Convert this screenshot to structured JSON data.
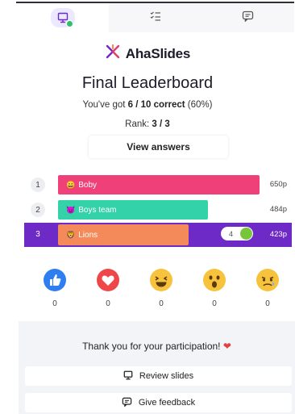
{
  "tabs": [
    {
      "icon": "presentation-icon",
      "active": true
    },
    {
      "icon": "checklist-icon",
      "active": false
    },
    {
      "icon": "chat-icon",
      "active": false
    }
  ],
  "brand": {
    "name": "AhaSlides",
    "accent": "#e23c6b"
  },
  "heading": {
    "title": "Final Leaderboard"
  },
  "score": {
    "prefix": "You've got ",
    "value": "6 / 10 correct",
    "percent": " (60%)",
    "rank_label": "Rank: ",
    "rank_value": "3 / 3"
  },
  "view_answers_label": "View answers",
  "leaderboard": [
    {
      "rank": "1",
      "name": "Boby",
      "points": "650p",
      "color": "#f0407a",
      "emoji": "😄"
    },
    {
      "rank": "2",
      "name": "Boys team",
      "points": "484p",
      "color": "#34d2a9",
      "emoji": "😈"
    },
    {
      "rank": "3",
      "name": "Lions",
      "points": "423p",
      "color": "#f48a59",
      "emoji": "🦁",
      "me": true,
      "toggle_value": "4"
    }
  ],
  "reactions": [
    {
      "icon": "thumbs-up-icon",
      "count": "0",
      "color": "#2e7ef2"
    },
    {
      "icon": "heart-icon",
      "count": "0",
      "color": "#ef4747"
    },
    {
      "icon": "laughing-face-icon",
      "count": "0",
      "color": "#f7c33c"
    },
    {
      "icon": "surprised-face-icon",
      "count": "0",
      "color": "#f7c33c"
    },
    {
      "icon": "sad-face-icon",
      "count": "0",
      "color": "#f7c33c"
    }
  ],
  "footer": {
    "thanks": "Thank you for your participation!",
    "review_label": "Review slides",
    "feedback_label": "Give feedback"
  }
}
